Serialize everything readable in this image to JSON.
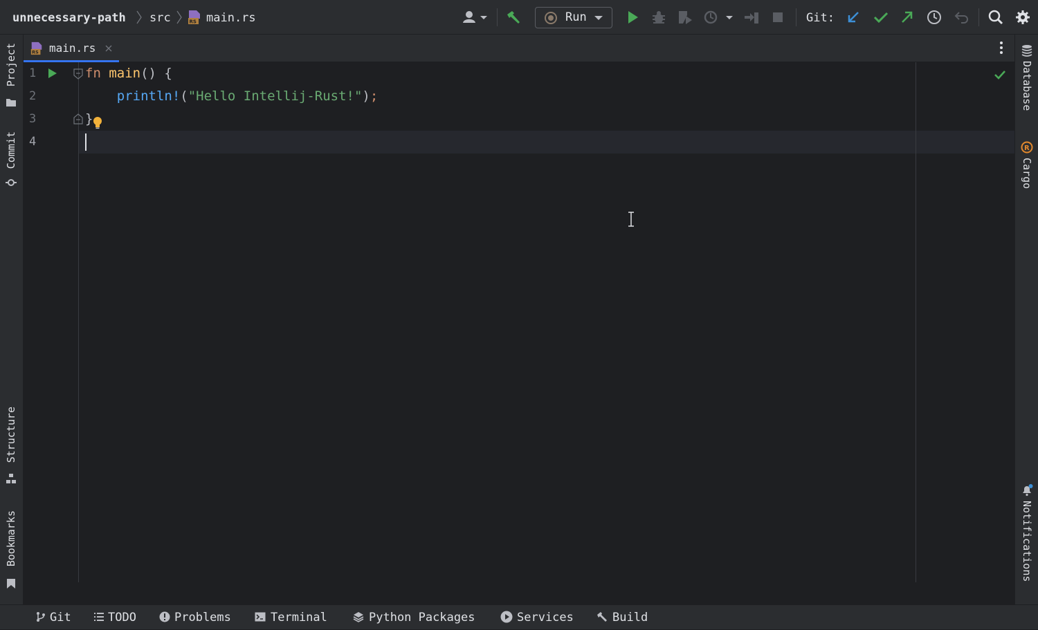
{
  "breadcrumb": {
    "project": "unnecessary-path",
    "folder": "src",
    "file": "main.rs"
  },
  "toolbar": {
    "run_config_label": "Run",
    "git_label": "Git:"
  },
  "tabs": [
    {
      "label": "main.rs",
      "active": true
    }
  ],
  "left_tools": {
    "project": "Project",
    "commit": "Commit",
    "structure": "Structure",
    "bookmarks": "Bookmarks"
  },
  "right_tools": {
    "database": "Database",
    "cargo": "Cargo",
    "notifications": "Notifications"
  },
  "editor": {
    "line_numbers": [
      "1",
      "2",
      "3",
      "4"
    ],
    "current_line": 4,
    "code": {
      "line1_kw": "fn",
      "line1_name": "main",
      "line1_rest": "() {",
      "line2_macro": "println!",
      "line2_open": "(",
      "line2_string": "\"Hello Intellij-Rust!\"",
      "line2_close": ")",
      "line2_semi": ";",
      "line3": "}"
    }
  },
  "bottom_tools": {
    "git": "Git",
    "todo": "TODO",
    "problems": "Problems",
    "terminal": "Terminal",
    "python_packages": "Python Packages",
    "services": "Services",
    "build": "Build"
  },
  "colors": {
    "accent": "#3574f0",
    "run_green": "#4aa957",
    "git_update_blue": "#3d8fd6",
    "hint_bulb": "#f2b13a"
  },
  "icons": {
    "run_gutter": "play-icon",
    "inspection_status": "check-icon",
    "intention": "lightbulb-icon"
  }
}
